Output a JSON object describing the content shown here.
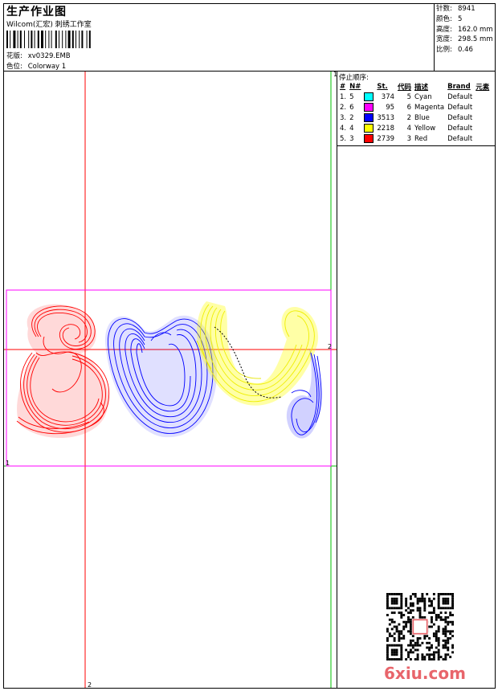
{
  "header": {
    "title": "生产作业图",
    "subtitle": "Wilcom(汇宏) 刺绣工作室",
    "design_label": "花版:",
    "design_value": "xv0329.EMB",
    "colorway_label": "色位:",
    "colorway_value": "Colorway 1"
  },
  "stats": [
    {
      "label": "针数:",
      "value": "8941"
    },
    {
      "label": "颜色:",
      "value": "5"
    },
    {
      "label": "高度:",
      "value": "162.0 mm"
    },
    {
      "label": "宽度:",
      "value": "298.5 mm"
    },
    {
      "label": "比例:",
      "value": "0.46"
    }
  ],
  "stop_panel": {
    "title": "停止顺序:",
    "columns": [
      "#",
      "N#",
      "St.",
      "代码",
      "描述",
      "Brand",
      "元素"
    ],
    "rows": [
      {
        "idx": "1.",
        "needle": "5",
        "color": "#00ffff",
        "stitches": "374",
        "code": "5",
        "desc": "Cyan",
        "brand": "Default"
      },
      {
        "idx": "2.",
        "needle": "6",
        "color": "#ff00ff",
        "stitches": "95",
        "code": "6",
        "desc": "Magenta",
        "brand": "Default"
      },
      {
        "idx": "3.",
        "needle": "2",
        "color": "#0000ff",
        "stitches": "3513",
        "code": "2",
        "desc": "Blue",
        "brand": "Default"
      },
      {
        "idx": "4.",
        "needle": "4",
        "color": "#ffff00",
        "stitches": "2218",
        "code": "4",
        "desc": "Yellow",
        "brand": "Default"
      },
      {
        "idx": "5.",
        "needle": "3",
        "color": "#ff0000",
        "stitches": "2739",
        "code": "3",
        "desc": "Red",
        "brand": "Default"
      }
    ]
  },
  "guides": {
    "marker_top": "1",
    "marker_right": "2",
    "marker_left": "1",
    "marker_bottom": "2"
  },
  "watermark": {
    "site": "6xiu.com"
  },
  "colors": {
    "red": "#ff0000",
    "blue": "#0000ff",
    "yellow": "#ffff00",
    "magenta": "#ff00ff",
    "green": "#00c000",
    "cyan": "#00ffff"
  }
}
